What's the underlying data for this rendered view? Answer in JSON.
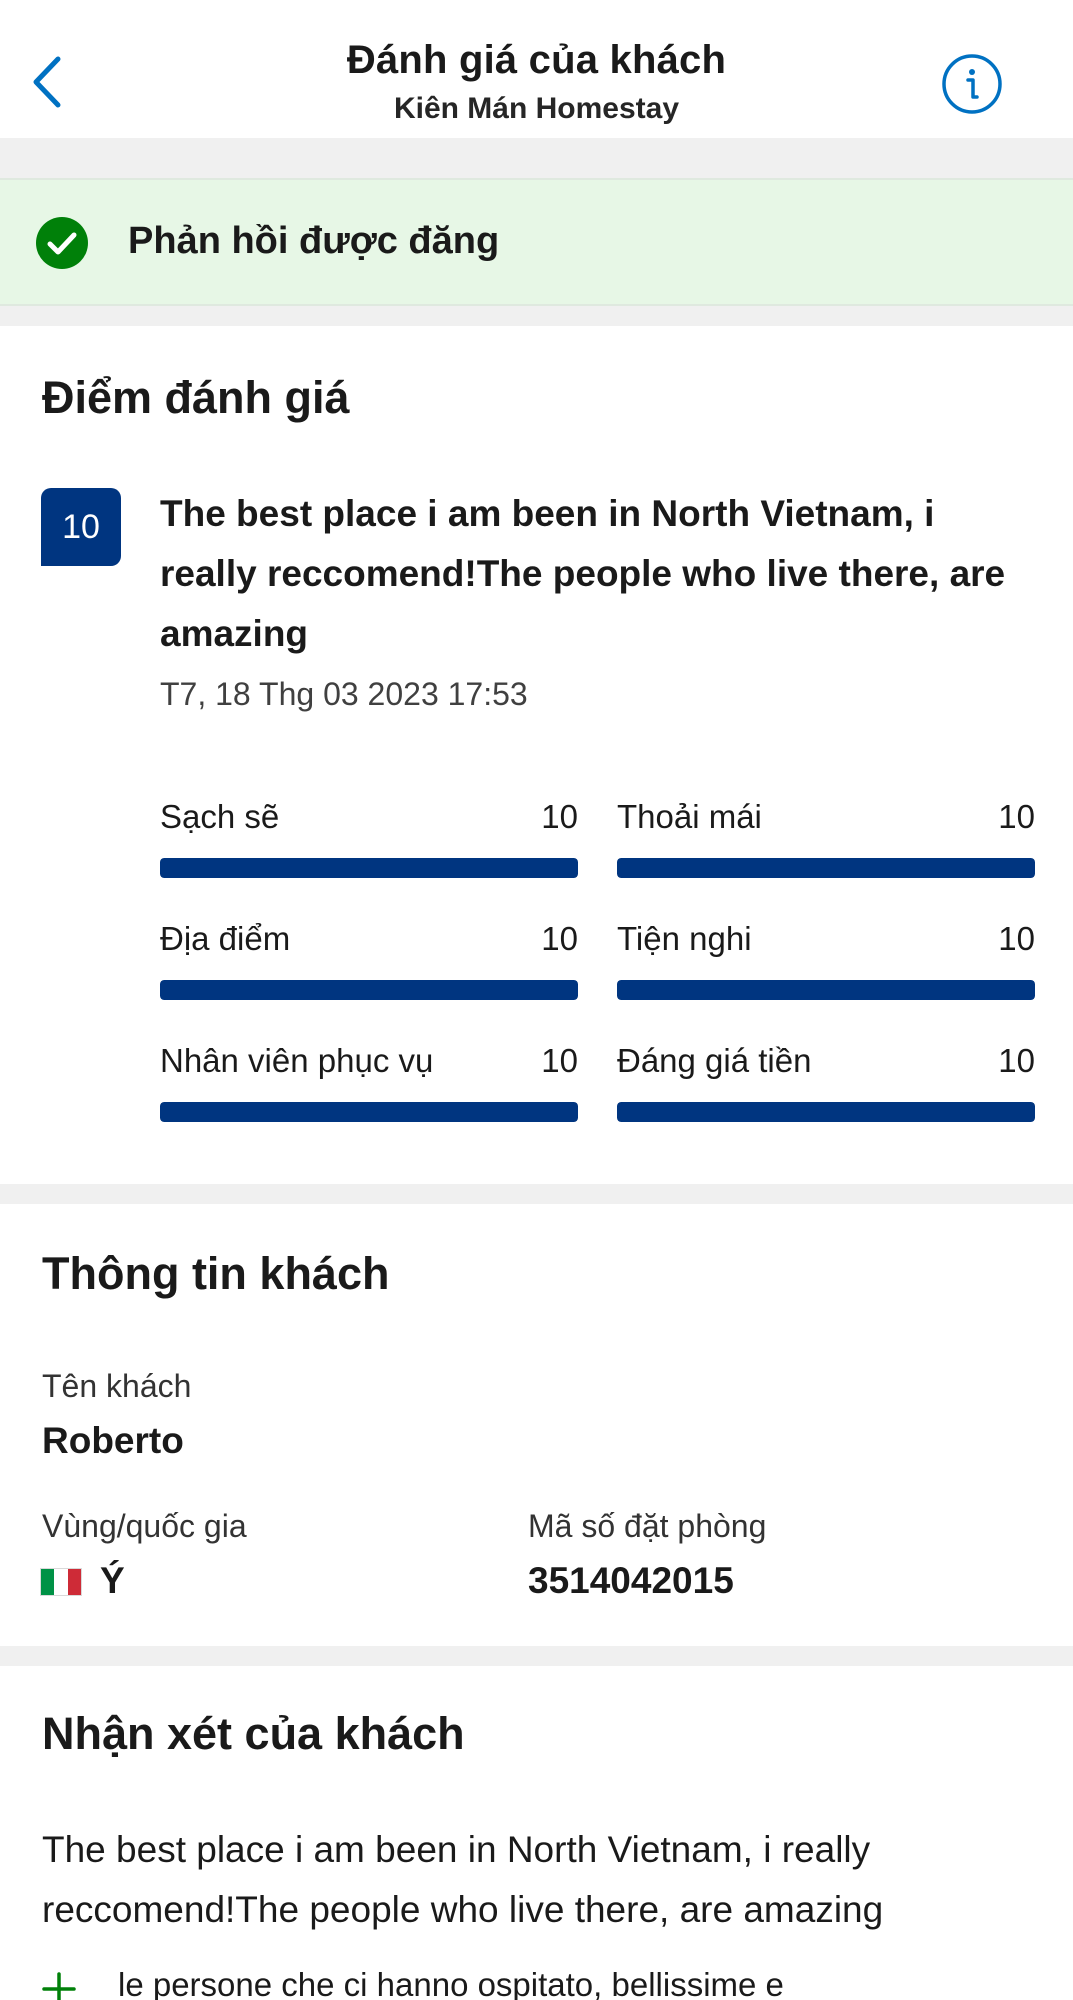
{
  "header": {
    "title": "Đánh giá của khách",
    "subtitle": "Kiên Mán Homestay",
    "back_icon": "chevron-left-icon",
    "info_icon": "info-circle-icon"
  },
  "banner": {
    "icon": "check-circle-icon",
    "text": "Phản hồi được đăng",
    "color": "#e7f7e6"
  },
  "score_section": {
    "title": "Điểm đánh giá",
    "score": "10",
    "review_title": "The best place i am been in North Vietnam, i really reccomend!The people who live there, are amazing",
    "date": "T7, 18 Thg 03 2023 17:53",
    "max_score": 10,
    "categories": [
      {
        "label": "Sạch sẽ",
        "value": "10",
        "score": 10
      },
      {
        "label": "Thoải mái",
        "value": "10",
        "score": 10
      },
      {
        "label": "Địa điểm",
        "value": "10",
        "score": 10
      },
      {
        "label": "Tiện nghi",
        "value": "10",
        "score": 10
      },
      {
        "label": "Nhân viên phục vụ",
        "value": "10",
        "score": 10
      },
      {
        "label": "Đáng giá tiền",
        "value": "10",
        "score": 10
      }
    ]
  },
  "guest_info": {
    "title": "Thông tin khách",
    "name_label": "Tên khách",
    "name": "Roberto",
    "country_label": "Vùng/quốc gia",
    "country": "Ý",
    "flag_icon": "italy-flag-icon",
    "booking_label": "Mã số đặt phòng",
    "booking_number": "3514042015"
  },
  "comments": {
    "title": "Nhận xét của khách",
    "text": "The best place i am been in North Vietnam, i really reccomend!The people who live there, are amazing",
    "positive_icon": "plus-icon",
    "positive_text": "le persone che ci hanno ospitato, bellissime e"
  },
  "colors": {
    "brand": "#003580",
    "positive": "#008009",
    "banner_bg": "#e7f7e6"
  }
}
